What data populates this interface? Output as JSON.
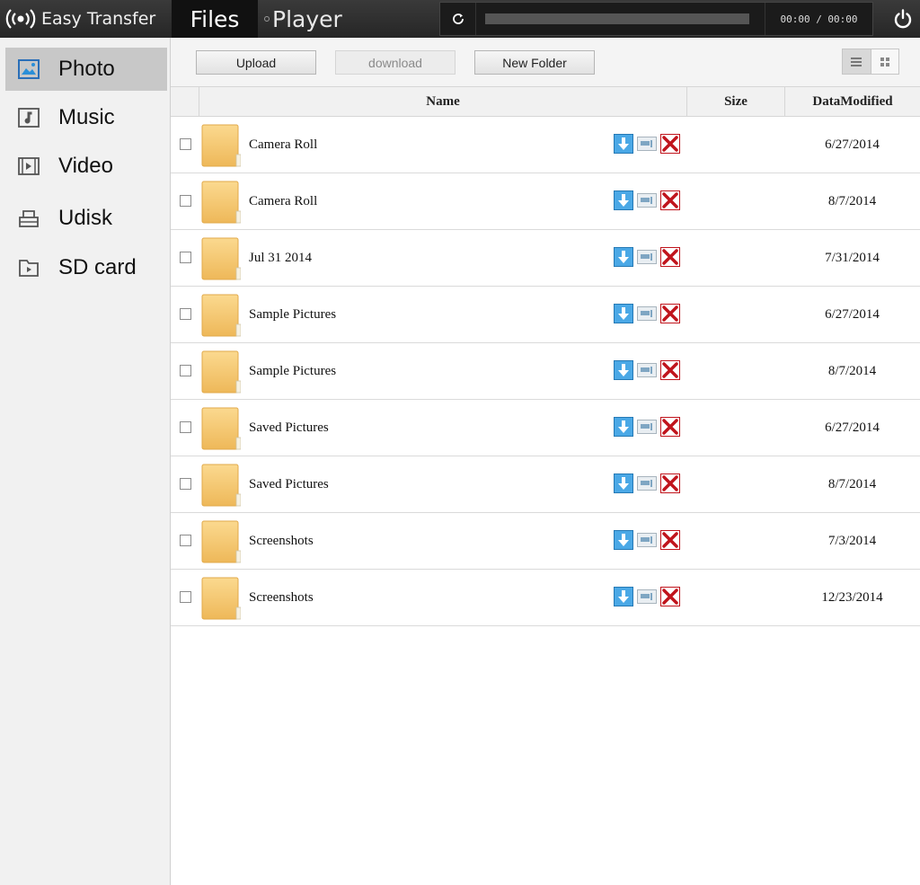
{
  "app": {
    "brand": "Easy Transfer"
  },
  "tabs": {
    "files": "Files",
    "player": "Player"
  },
  "player": {
    "time": "00:00 / 00:00",
    "progress": 0
  },
  "sidebar": {
    "items": [
      {
        "label": "Photo",
        "icon": "photo-icon",
        "active": true
      },
      {
        "label": "Music",
        "icon": "music-icon",
        "active": false
      },
      {
        "label": "Video",
        "icon": "video-icon",
        "active": false
      },
      {
        "label": "Udisk",
        "icon": "udisk-icon",
        "active": false
      },
      {
        "label": "SD card",
        "icon": "sd-card-icon",
        "active": false
      }
    ]
  },
  "toolbar": {
    "upload": "Upload",
    "download": "download",
    "new_folder": "New Folder",
    "view": "list"
  },
  "table": {
    "columns": {
      "name": "Name",
      "size": "Size",
      "modified": "DataModified"
    },
    "rows": [
      {
        "name": "Camera Roll",
        "size": "",
        "modified": "6/27/2014"
      },
      {
        "name": "Camera Roll",
        "size": "",
        "modified": "8/7/2014"
      },
      {
        "name": "Jul 31 2014",
        "size": "",
        "modified": "7/31/2014"
      },
      {
        "name": "Sample Pictures",
        "size": "",
        "modified": "6/27/2014"
      },
      {
        "name": "Sample Pictures",
        "size": "",
        "modified": "8/7/2014"
      },
      {
        "name": "Saved Pictures",
        "size": "",
        "modified": "6/27/2014"
      },
      {
        "name": "Saved Pictures",
        "size": "",
        "modified": "8/7/2014"
      },
      {
        "name": "Screenshots",
        "size": "",
        "modified": "7/3/2014"
      },
      {
        "name": "Screenshots",
        "size": "",
        "modified": "12/23/2014"
      }
    ]
  },
  "colors": {
    "topbar": "#262626",
    "active_side": "#c8c8c8",
    "accent_blue": "#2a8fd8",
    "delete_red": "#c0141c",
    "folder": "#f5c66a"
  }
}
